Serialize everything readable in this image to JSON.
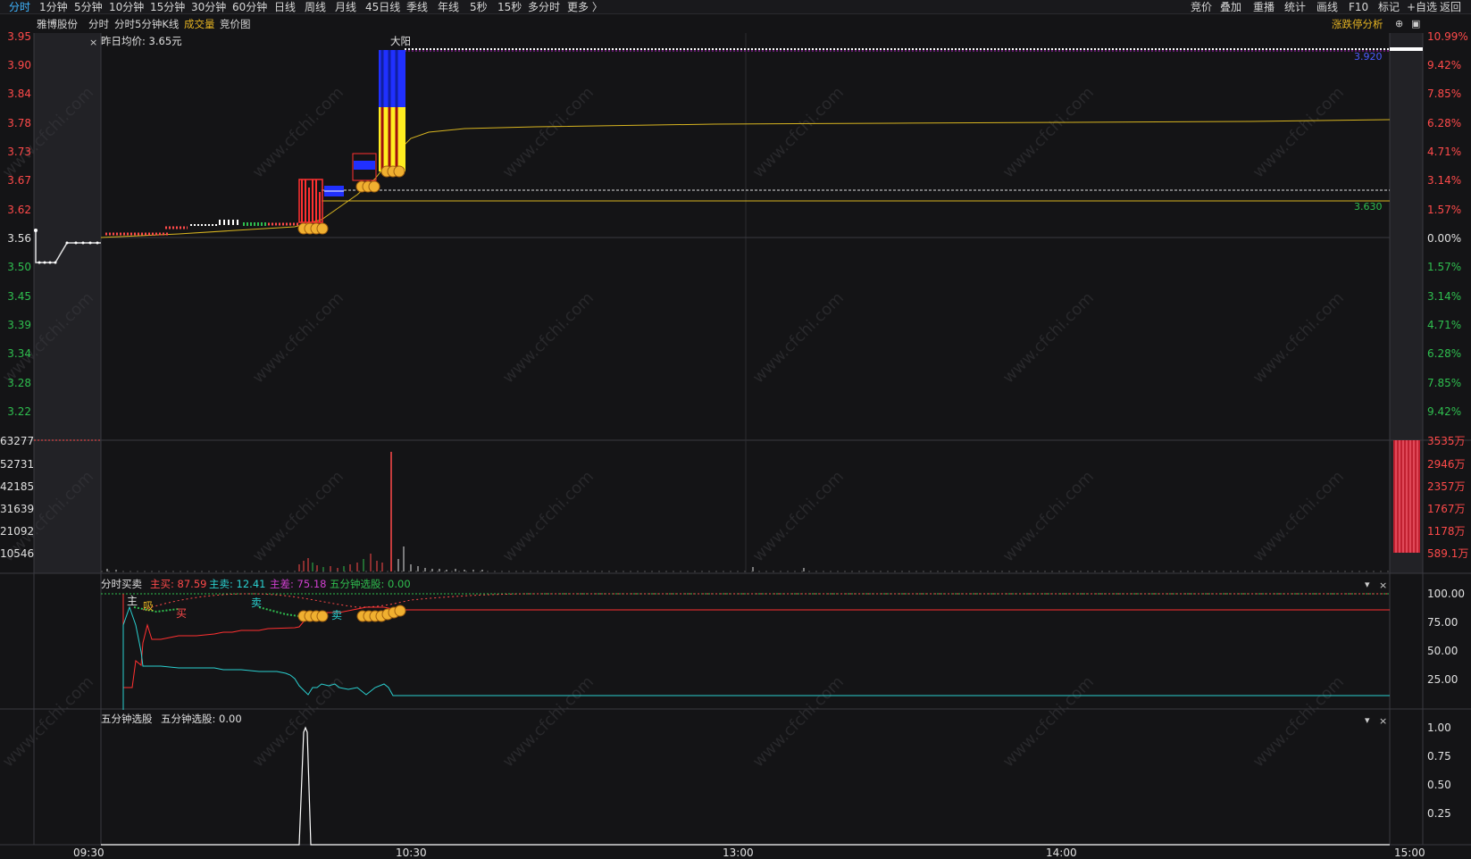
{
  "toolbar": {
    "period_tabs": [
      "分时",
      "1分钟",
      "5分钟",
      "10分钟",
      "15分钟",
      "30分钟",
      "60分钟",
      "日线",
      "周线",
      "月线",
      "45日线",
      "季线",
      "年线",
      "5秒",
      "15秒",
      "多分时",
      "更多 〉"
    ],
    "right_tabs": [
      "竞价",
      "叠加",
      "重播",
      "统计",
      "画线",
      "F10",
      "标记",
      "+自选",
      "返回"
    ]
  },
  "subbar": {
    "stock_name": "雅博股份",
    "mode_label": "分时",
    "kline_label": "分时5分钟K线",
    "volume_label": "成交量",
    "auction_label": "竞价图",
    "analysis_label": "涨跌停分析"
  },
  "price_panel": {
    "yesterday_avg": "昨日均价:  3.65元",
    "annotation": "大阳",
    "high_label": "3.920",
    "ref_label": "3.630",
    "left_axis": [
      "3.95",
      "3.90",
      "3.84",
      "3.78",
      "3.73",
      "3.67",
      "3.62",
      "3.56",
      "3.50",
      "3.45",
      "3.39",
      "3.34",
      "3.28",
      "3.22"
    ],
    "right_axis": [
      "10.99%",
      "9.42%",
      "7.85%",
      "6.28%",
      "4.71%",
      "3.14%",
      "1.57%",
      "0.00%",
      "1.57%",
      "3.14%",
      "4.71%",
      "6.28%",
      "7.85%",
      "9.42%"
    ],
    "colors": {
      "up": "#ff4a4a",
      "down": "#2fbf4f",
      "avg_line": "#d8b520"
    }
  },
  "volume_panel": {
    "left_axis": [
      "63277",
      "52731",
      "42185",
      "31639",
      "21092",
      "10546"
    ],
    "right_axis": [
      "3535万",
      "2946万",
      "2357万",
      "1767万",
      "1178万",
      "589.1万"
    ]
  },
  "buysell_panel": {
    "title": "分时买卖",
    "main_buy": "主买: 87.59",
    "main_sell": "主卖: 12.41",
    "main_diff": "主差: 75.18",
    "five_min": "五分钟选股: 0.00",
    "right_axis": [
      "100.00",
      "75.00",
      "50.00",
      "25.00"
    ],
    "marks": [
      "主",
      "吸",
      "买",
      "卖",
      "卖"
    ]
  },
  "five_panel": {
    "title": "五分钟选股",
    "value": "五分钟选股: 0.00",
    "right_axis": [
      "1.00",
      "0.75",
      "0.50",
      "0.25"
    ]
  },
  "time_axis": [
    "09:30",
    "10:30",
    "13:00",
    "14:00",
    "15:00"
  ],
  "watermark": "www.cfchi.com"
}
